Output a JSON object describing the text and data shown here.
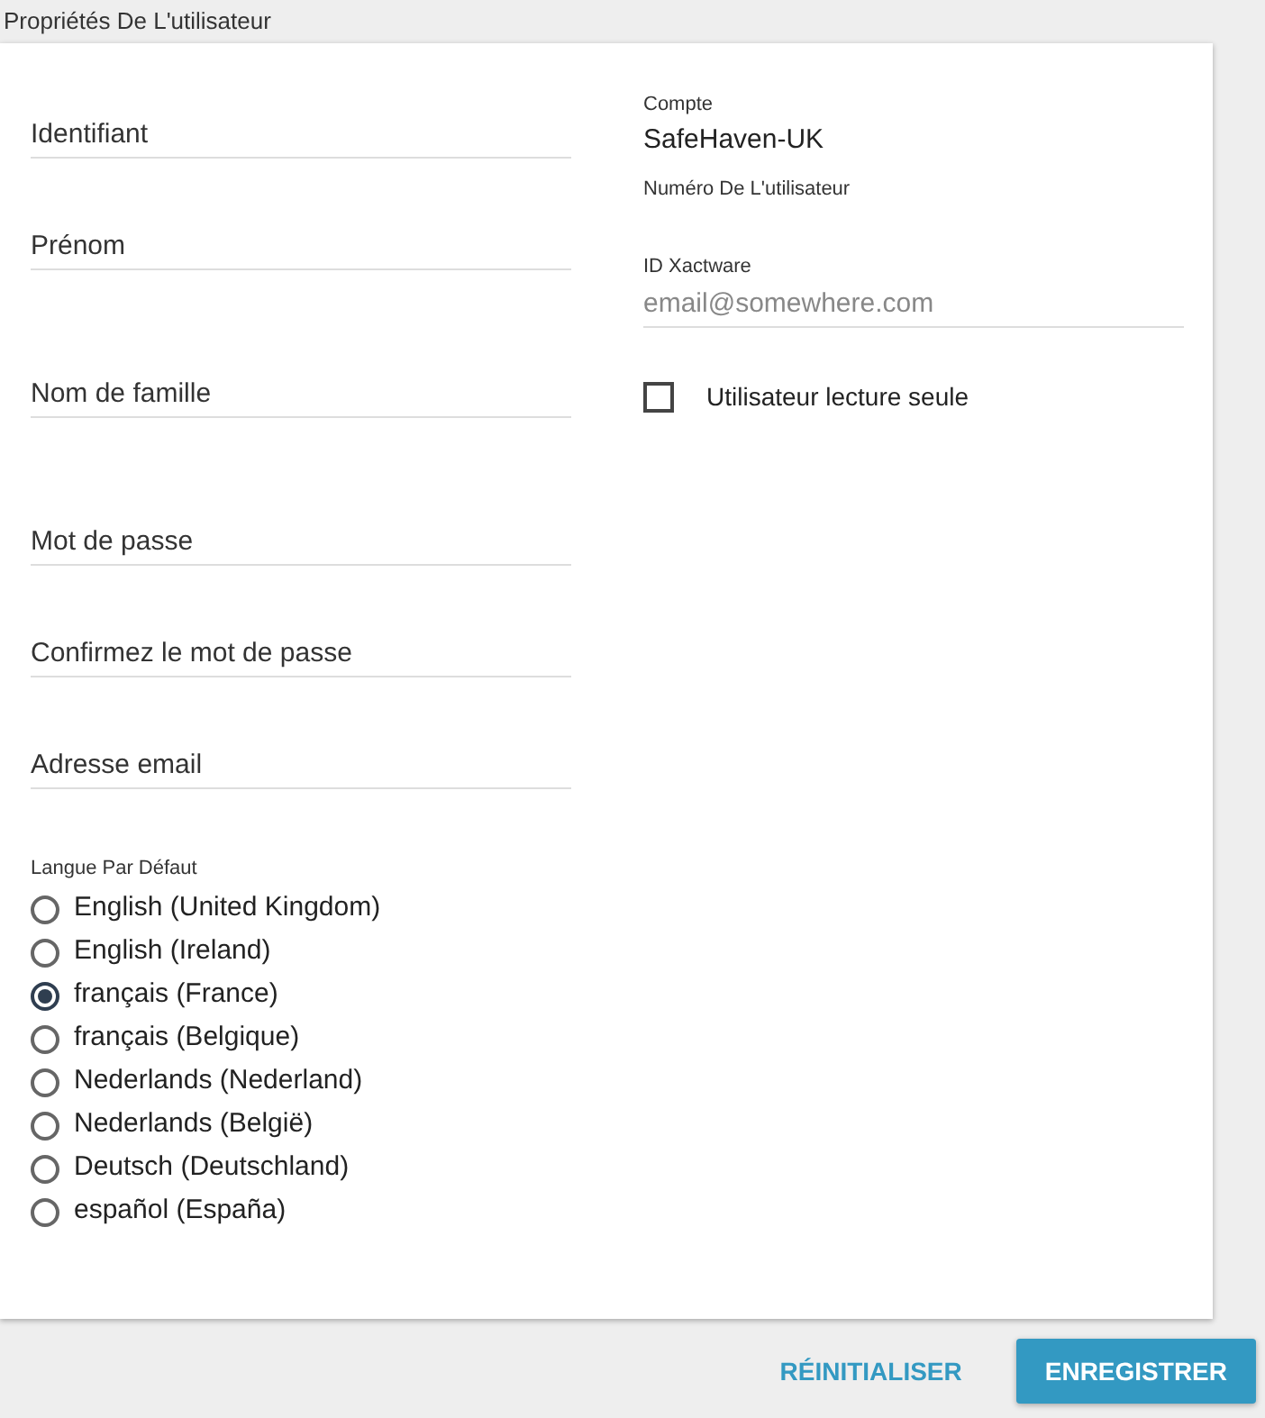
{
  "title": "Propriétés De L'utilisateur",
  "left_fields": [
    {
      "placeholder": "Identifiant"
    },
    {
      "placeholder": "Prénom"
    },
    {
      "placeholder": "Nom de famille"
    },
    {
      "placeholder": "Mot de passe"
    },
    {
      "placeholder": "Confirmez le mot de passe"
    },
    {
      "placeholder": "Adresse email"
    }
  ],
  "account": {
    "label": "Compte",
    "value": "SafeHaven-UK"
  },
  "user_number": {
    "label": "Numéro De L'utilisateur"
  },
  "xactware_id": {
    "label": "ID Xactware",
    "placeholder": "email@somewhere.com"
  },
  "read_only": {
    "label": "Utilisateur lecture seule",
    "checked": false
  },
  "language": {
    "label": "Langue Par Défaut",
    "options": [
      {
        "label": "English (United Kingdom)",
        "selected": false
      },
      {
        "label": "English (Ireland)",
        "selected": false
      },
      {
        "label": "français (France)",
        "selected": true
      },
      {
        "label": "français (Belgique)",
        "selected": false
      },
      {
        "label": "Nederlands (Nederland)",
        "selected": false
      },
      {
        "label": "Nederlands (België)",
        "selected": false
      },
      {
        "label": "Deutsch (Deutschland)",
        "selected": false
      },
      {
        "label": "español (España)",
        "selected": false
      }
    ]
  },
  "buttons": [
    {
      "label": "RÉINITIALISER",
      "kind": "text"
    },
    {
      "label": "ENREGISTRER",
      "kind": "primary"
    }
  ]
}
